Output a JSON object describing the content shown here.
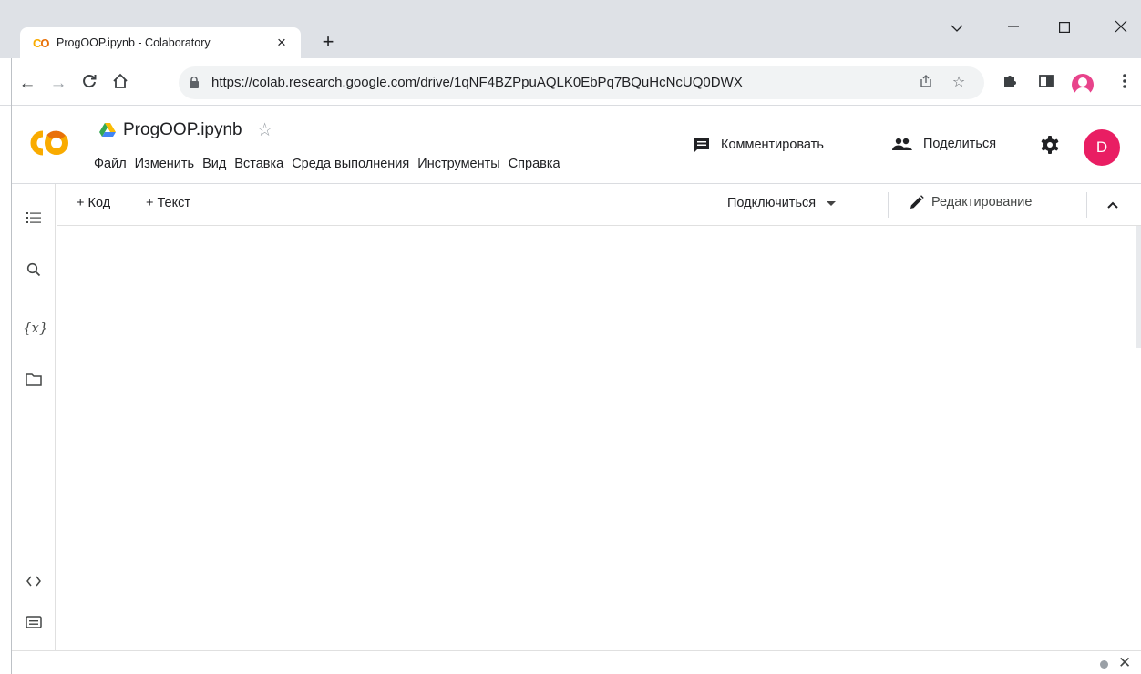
{
  "browser": {
    "tab": {
      "favicon": "CO",
      "title": "ProgOOP.ipynb - Colaboratory",
      "close_glyph": "×"
    },
    "new_tab_glyph": "+",
    "window_controls": {
      "chevron": "⌄",
      "minimize": "—",
      "maximize": "☐",
      "close": "✕"
    },
    "nav": {
      "back": "←",
      "forward": "→",
      "reload": "C",
      "home": "⌂"
    },
    "address": "https://colab.research.google.com/drive/1qNF4BZPpuAQLK0EbPq7BQuHcNcUQ0DWX"
  },
  "colab": {
    "notebook_title": "ProgOOP.ipynb",
    "star_glyph": "☆",
    "menu": [
      "Файл",
      "Изменить",
      "Вид",
      "Вставка",
      "Среда выполнения",
      "Инструменты",
      "Справка"
    ],
    "comment_label": "Комментировать",
    "share_label": "Поделиться",
    "avatar_letter": "D",
    "add_code_label": "+ Код",
    "add_text_label": "+ Текст",
    "connect_label": "Подключиться",
    "editing_label": "Редактирование",
    "rail": {
      "toc": "≡",
      "search": "⌕",
      "variables": "{x}",
      "files": "▭",
      "snippets": "‹›",
      "terminal": "▤"
    },
    "status_close": "✕"
  },
  "colors": {
    "tabbar_bg": "#dee1e6",
    "avatar_bg": "#e91e63",
    "colab_orange": "#f9ab00",
    "colab_orange_dark": "#e8710a"
  }
}
